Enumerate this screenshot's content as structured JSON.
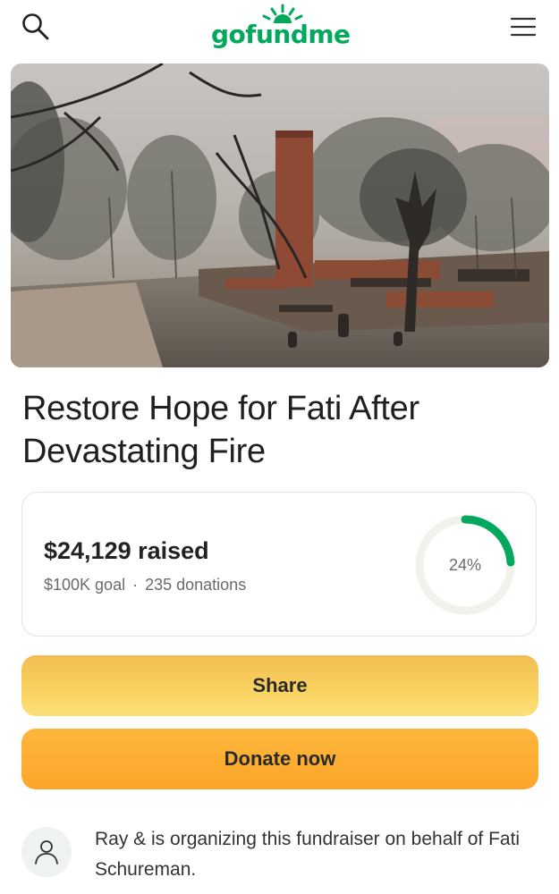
{
  "header": {
    "logo_text": "gofundme",
    "search_icon": "search-icon",
    "menu_icon": "hamburger-menu-icon",
    "brand_color": "#02a95c"
  },
  "hero": {
    "image_description_icon": "fire-damage-photo"
  },
  "campaign": {
    "title": "Restore Hope for Fati After Devastating Fire"
  },
  "progress": {
    "raised_text": "$24,129 raised",
    "goal_text": "$100K goal",
    "separator": "·",
    "donations_text": "235 donations",
    "percent_label": "24%",
    "percent_value": 0.24,
    "ring_color": "#02a95c",
    "ring_track_color": "#f2f1ec"
  },
  "actions": {
    "share_label": "Share",
    "donate_label": "Donate now"
  },
  "organizer": {
    "text": "Ray & is organizing this fundraiser on behalf of Fati Schureman."
  }
}
